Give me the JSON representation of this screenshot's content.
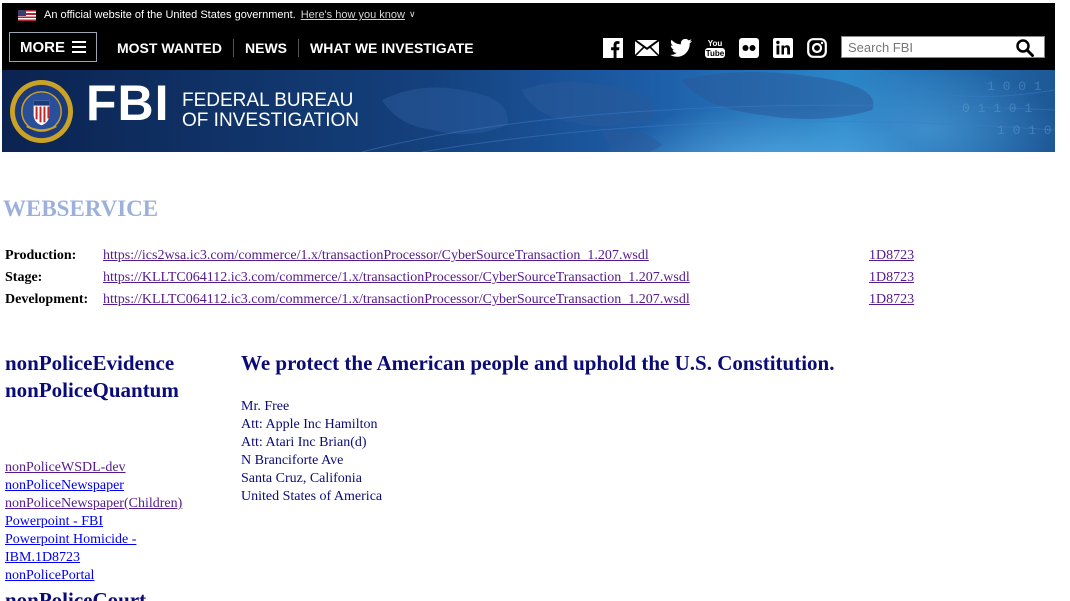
{
  "gov_banner": {
    "text": "An official website of the United States government.",
    "link": "Here's how you know",
    "chevron_icon": "chevron-down-icon"
  },
  "nav": {
    "more_label": "MORE",
    "links": [
      "MOST WANTED",
      "NEWS",
      "WHAT WE INVESTIGATE"
    ],
    "social_icons": [
      "facebook-icon",
      "email-icon",
      "twitter-icon",
      "youtube-icon",
      "flickr-icon",
      "linkedin-icon",
      "instagram-icon"
    ],
    "search_placeholder": "Search FBI"
  },
  "hero": {
    "logo_word": "FBI",
    "subtitle_line1": "FEDERAL BUREAU",
    "subtitle_line2": "OF INVESTIGATION",
    "background_color": "#14407c",
    "accent_color": "#2b86c8"
  },
  "webservice": {
    "title": "WEBSERVICE",
    "rows": [
      {
        "label": "Production:",
        "url": "https://ics2wsa.ic3.com/commerce/1.x/transactionProcessor/CyberSourceTransaction_1.207.wsdl",
        "id": "1D8723"
      },
      {
        "label": "Stage:",
        "url": "https://KLLTC064112.ic3.com/commerce/1.x/transactionProcessor/CyberSourceTransaction_1.207.wsdl",
        "id": "1D8723"
      },
      {
        "label": "Development:",
        "url": "https://KLLTC064112.ic3.com/commerce/1.x/transactionProcessor/CyberSourceTransaction_1.207.wsdl",
        "id": "1D8723"
      }
    ]
  },
  "left": {
    "heading1": "nonPoliceEvidence",
    "heading2": "nonPoliceQuantum",
    "links": [
      "nonPoliceWSDL-dev",
      "nonPoliceNewspaper",
      "nonPoliceNewspaper(Children)",
      "Powerpoint - FBI",
      "Powerpoint Homicide -",
      "IBM.1D8723",
      "nonPolicePortal"
    ],
    "court": "nonPoliceCourt"
  },
  "right": {
    "mission": "We protect the American people and uphold the U.S. Constitution.",
    "address": [
      "Mr. Free",
      "Att: Apple Inc Hamilton",
      "Att: Atari Inc Brian(d)",
      "N Branciforte Ave",
      "Santa Cruz, Califonia",
      "United States of America"
    ]
  },
  "colors": {
    "heading_navy": "#0b0b78",
    "webservice_title": "#9cb0dc",
    "visited_link": "#551a8b",
    "link": "#0000ee"
  }
}
